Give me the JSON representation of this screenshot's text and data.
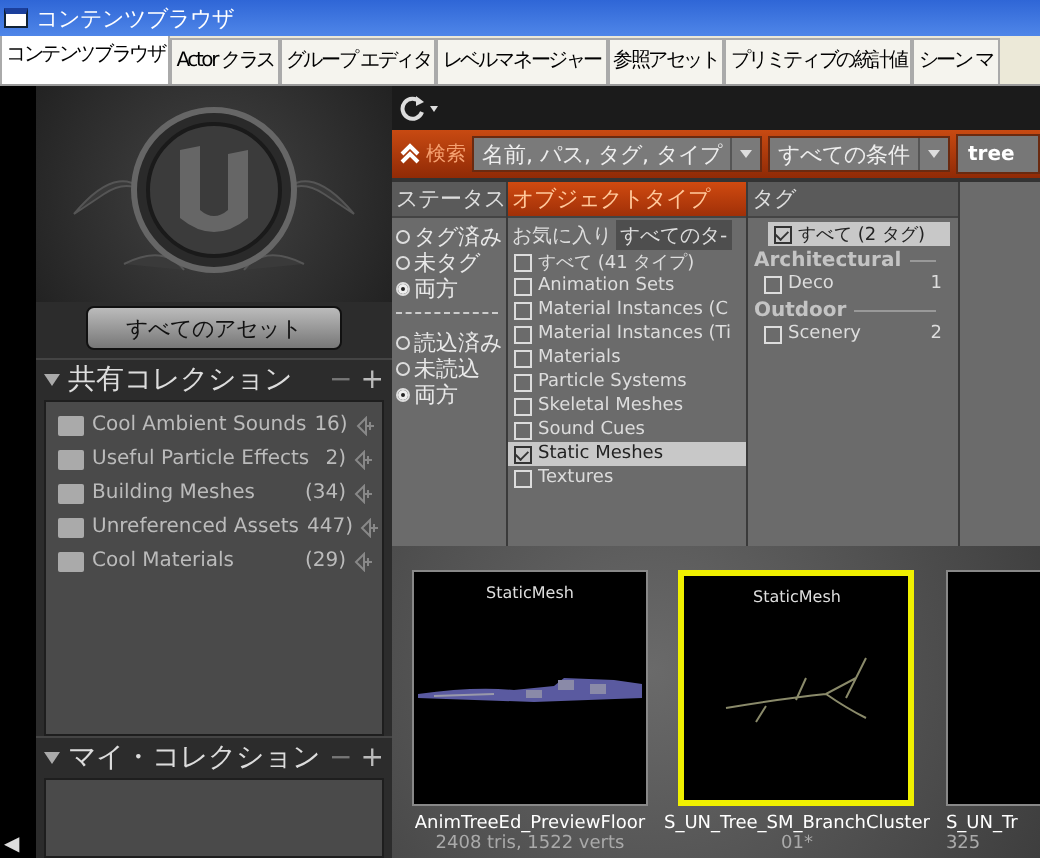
{
  "window": {
    "title": "コンテンツブラウザ"
  },
  "tabs": [
    {
      "label": "コンテンツブラウザ",
      "selected": true
    },
    {
      "label": "Actor クラス",
      "selected": false
    },
    {
      "label": "グループ エディタ",
      "selected": false
    },
    {
      "label": "レベルマネージャー",
      "selected": false
    },
    {
      "label": "参照アセット",
      "selected": false
    },
    {
      "label": "プリミティブの統計値",
      "selected": false
    },
    {
      "label": "シーン マ",
      "selected": false
    }
  ],
  "sidebar": {
    "all_assets_button": "すべてのアセット",
    "shared_collections": {
      "title": "共有コレクション",
      "remove": "−",
      "add": "+",
      "expanded": true,
      "items": [
        {
          "name": "Cool Ambient Sounds",
          "count": "16)"
        },
        {
          "name": "Useful Particle Effects",
          "count": "2)"
        },
        {
          "name": "Building Meshes",
          "count": "(34)"
        },
        {
          "name": "Unreferenced Assets",
          "count": "447)"
        },
        {
          "name": "Cool Materials",
          "count": "(29)"
        }
      ]
    },
    "my_collections": {
      "title": "マイ・コレクション",
      "remove": "−",
      "add": "+",
      "expanded": true
    },
    "collapse_arrow": "◀"
  },
  "search": {
    "label": "検索",
    "field_menu": "名前, パス, タグ, タイプ",
    "match_menu": "すべての条件",
    "value": "tree"
  },
  "filters": {
    "headers": [
      {
        "label": "ステータス",
        "selected": false
      },
      {
        "label": "オブジェクトタイプ",
        "selected": true
      },
      {
        "label": "タグ",
        "selected": false
      }
    ],
    "status_groups": [
      [
        {
          "label": "タグ済み",
          "selected": false
        },
        {
          "label": "未タグ",
          "selected": false
        },
        {
          "label": "両方",
          "selected": true
        }
      ],
      [
        {
          "label": "読込済み",
          "selected": false
        },
        {
          "label": "未読込",
          "selected": false
        },
        {
          "label": "両方",
          "selected": true
        }
      ]
    ],
    "type_tabs": [
      {
        "label": "お気に入り",
        "selected": false
      },
      {
        "label": "すべてのタ-",
        "selected": true
      }
    ],
    "types": [
      {
        "label": "すべて (41 タイプ)",
        "checked": false,
        "selected": false
      },
      {
        "label": "Animation Sets",
        "checked": false,
        "selected": false
      },
      {
        "label": "Material Instances (C",
        "checked": false,
        "selected": false
      },
      {
        "label": "Material Instances (Ti",
        "checked": false,
        "selected": false
      },
      {
        "label": "Materials",
        "checked": false,
        "selected": false
      },
      {
        "label": "Particle Systems",
        "checked": false,
        "selected": false
      },
      {
        "label": "Skeletal Meshes",
        "checked": false,
        "selected": false
      },
      {
        "label": "Sound Cues",
        "checked": false,
        "selected": false
      },
      {
        "label": "Static Meshes",
        "checked": true,
        "selected": true
      },
      {
        "label": "Textures",
        "checked": false,
        "selected": false
      }
    ],
    "tag_all": {
      "label": "すべて (2 タグ)",
      "checked": true,
      "selected": true
    },
    "tag_groups": [
      {
        "name": "Architectural",
        "items": [
          {
            "label": "Deco",
            "count": "1",
            "checked": false
          }
        ]
      },
      {
        "name": "Outdoor",
        "items": [
          {
            "label": "Scenery",
            "count": "2",
            "checked": false
          }
        ]
      }
    ]
  },
  "assets": [
    {
      "kind": "floor",
      "type": "StaticMesh",
      "name": "AnimTreeEd_PreviewFloor",
      "info": "2408 tris, 1522 verts",
      "selected": false
    },
    {
      "kind": "branch",
      "type": "StaticMesh",
      "name": "S_UN_Tree_SM_BranchCluster",
      "info": "01*",
      "selected": true
    },
    {
      "kind": "cut",
      "name": "S_UN_Tr",
      "info": "325",
      "selected": false
    }
  ]
}
